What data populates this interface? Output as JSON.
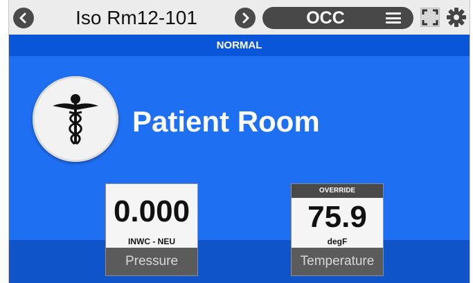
{
  "header": {
    "title": "Iso Rm12-101",
    "mode": "OCC",
    "prev_icon": "chevron-left-icon",
    "next_icon": "chevron-right-icon",
    "menu_icon": "menu-icon",
    "expand_icon": "expand-icon",
    "settings_icon": "gear-icon"
  },
  "status": "NORMAL",
  "room": {
    "icon": "caduceus-icon",
    "name": "Patient Room"
  },
  "tiles": [
    {
      "value": "0.000",
      "unit": "INWC - NEU",
      "label": "Pressure",
      "override": ""
    },
    {
      "value": "75.9",
      "unit": "degF",
      "label": "Temperature",
      "override": "OVERRIDE"
    }
  ],
  "colors": {
    "background": "#1f6ff2",
    "status_strip": "#0a56d8",
    "top_bar": "#ececec",
    "pill": "#484848"
  }
}
